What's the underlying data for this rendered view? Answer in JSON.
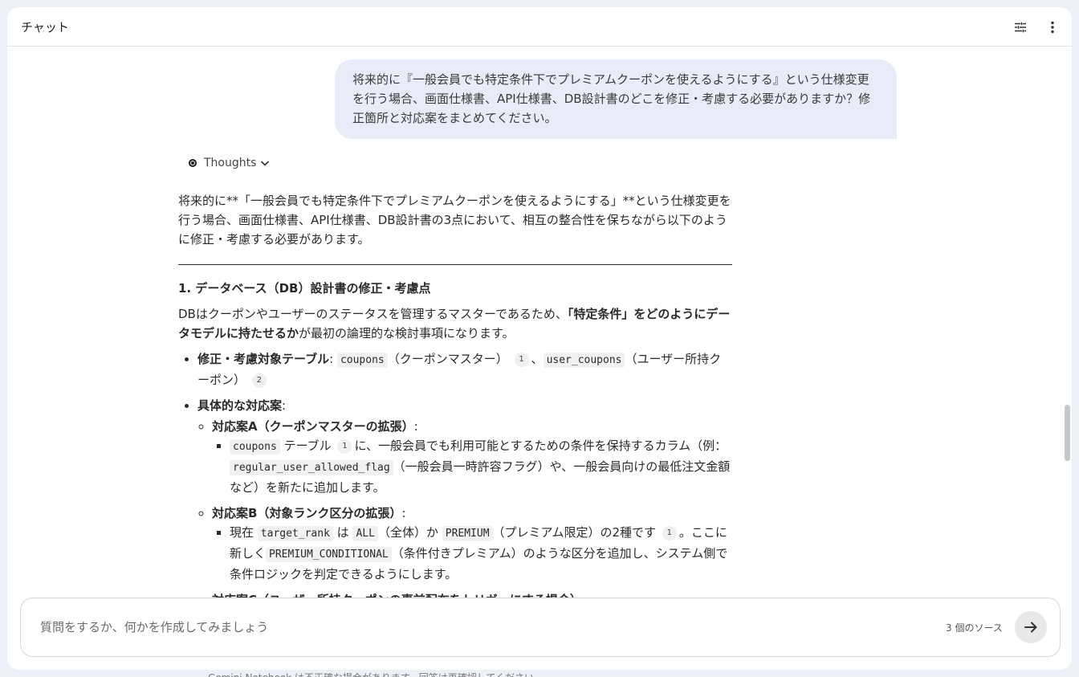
{
  "header": {
    "title": "チャット",
    "settings_icon": "tune-icon",
    "more_icon": "more-vert-icon"
  },
  "user_message": "将来的に『一般会員でも特定条件下でプレミアムクーポンを使えるようにする』という仕様変更を行う場合、画面仕様書、API仕様書、DB設計書のどこを修正・考慮する必要がありますか？修正箇所と対応案をまとめてください。",
  "thoughts": {
    "label": "Thoughts"
  },
  "response": {
    "intro_1": "将来的に**「一般会員でも特定条件下でプレミアムクーポンを使えるようにする」**という仕様変更を行う場合、画面仕様書、API仕様書、DB設計書の3点において、相互の整合性を保ちながら以下のように修正・考慮する必要があります。",
    "section1_heading": "1. データベース（DB）設計書の修正・考慮点",
    "section1_p_a": "DBはクーポンやユーザーのステータスを管理するマスターであるため、",
    "section1_p_bold": "「特定条件」をどのようにデータモデルに持たせるか",
    "section1_p_b": "が最初の論理的な検討事項になります。",
    "bullet1_label": "修正・考慮対象テーブル",
    "bullet1_colon": ":",
    "code_coupons": "coupons",
    "bullet1_t1": "（クーポンマスター）",
    "cite1": "1",
    "bullet1_sep": "、",
    "code_user_coupons": "user_coupons",
    "bullet1_t2": "（ユーザー所持クーポン）",
    "cite2": "2",
    "bullet2_label": "具体的な対応案",
    "bullet2_colon": ":",
    "planA_title": "対応案A（クーポンマスターの拡張）",
    "planA_colon": ":",
    "planA_code": "coupons",
    "planA_t1": "テーブル",
    "planA_t2": "に、一般会員でも利用可能とするための条件を保持するカラム（例：",
    "planA_code2": "regular_user_allowed_flag",
    "planA_t3": "（一般会員一時許容フラグ）や、一般会員向けの最低注文金額など）を新たに追加します。",
    "planB_title": "対応案B（対象ランク区分の拡張）",
    "planB_colon": ":",
    "planB_t1": "現在",
    "planB_code1": "target_rank",
    "planB_t2": "は",
    "planB_code2": "ALL",
    "planB_t3": "（全体）か",
    "planB_code3": "PREMIUM",
    "planB_t4": "（プレミアム限定）の2種です",
    "planB_t5": "。ここに新しく",
    "planB_code4": "PREMIUM_CONDITIONAL",
    "planB_t6": "（条件付きプレミアム）のような区分を追加し、システム側で条件ロジックを判定できるようにします。",
    "planC_title": "対応案C（ユーザー所持クーポンの事前配布をトリガーにする場合）",
    "planC_colon": ":"
  },
  "input": {
    "placeholder": "質問をするか、何かを作成してみましょう",
    "sources": "3 個のソース",
    "send_icon": "arrow-right-icon"
  },
  "footer": "Gemini Notebook は不正確な場合があります。回答は再確認してください。"
}
